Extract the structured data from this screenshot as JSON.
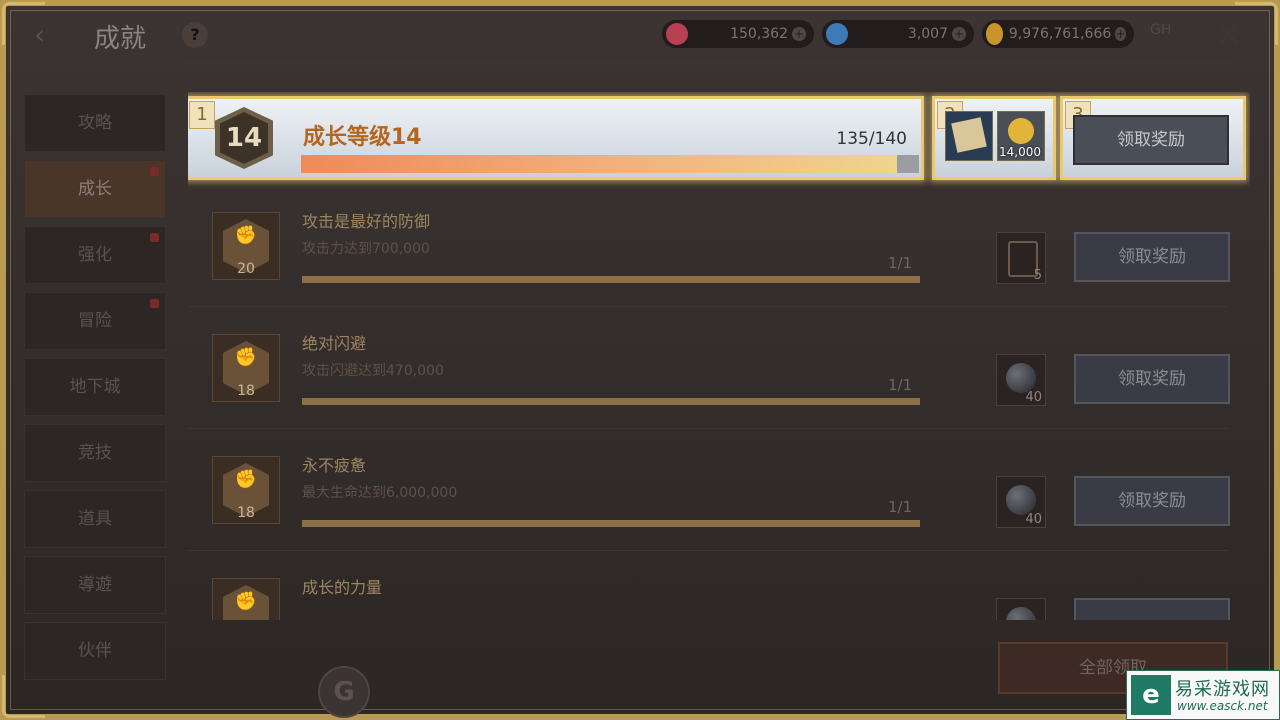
{
  "header": {
    "title": "成就",
    "help": "?",
    "currencies": [
      {
        "name": "red-gem",
        "value": "150,362",
        "color": "#b84050"
      },
      {
        "name": "blue-gem",
        "value": "3,007",
        "color": "#3e7ab8"
      },
      {
        "name": "gold",
        "value": "9,976,761,666",
        "color": "#c8952c"
      }
    ],
    "extra": "GH"
  },
  "sidebar": {
    "items": [
      {
        "label": "攻略",
        "dot": false,
        "active": false
      },
      {
        "label": "成长",
        "dot": true,
        "active": true
      },
      {
        "label": "强化",
        "dot": true,
        "active": false
      },
      {
        "label": "冒险",
        "dot": true,
        "active": false
      },
      {
        "label": "地下城",
        "dot": false,
        "active": false
      },
      {
        "label": "竞技",
        "dot": false,
        "active": false
      },
      {
        "label": "道具",
        "dot": false,
        "active": false
      },
      {
        "label": "導遊",
        "dot": false,
        "active": false
      },
      {
        "label": "伙伴",
        "dot": false,
        "active": false
      }
    ]
  },
  "highlight": {
    "markers": [
      "1",
      "2",
      "3"
    ],
    "level_badge": "14",
    "title": "成长等级14",
    "progress_text": "135/140",
    "progress": 0.964,
    "rewards": [
      {
        "icon": "scroll-icon",
        "count": ""
      },
      {
        "icon": "gold-coins-icon",
        "count": "14,000"
      }
    ],
    "button": "领取奖励"
  },
  "rows": [
    {
      "level": "20",
      "title": "攻击是最好的防御",
      "desc": "攻击力达到700,000",
      "progress_text": "1/1",
      "progress": 1,
      "reward_icon": "card-icon",
      "reward_count": "5",
      "button": "领取奖励"
    },
    {
      "level": "18",
      "title": "绝对闪避",
      "desc": "攻击闪避达到470,000",
      "progress_text": "1/1",
      "progress": 1,
      "reward_icon": "orb-icon",
      "reward_count": "40",
      "button": "领取奖励"
    },
    {
      "level": "18",
      "title": "永不疲惫",
      "desc": "最大生命达到6,000,000",
      "progress_text": "1/1",
      "progress": 1,
      "reward_icon": "orb-icon",
      "reward_count": "40",
      "button": "领取奖励"
    },
    {
      "level": "",
      "title": "成长的力量",
      "desc": "",
      "progress_text": "",
      "progress": 0,
      "reward_icon": "orb-icon",
      "reward_count": "",
      "button": ""
    }
  ],
  "footer": {
    "collect_all": "全部领取",
    "g_button": "G"
  },
  "watermark": {
    "name": "易采游戏网",
    "url": "www.easck.net",
    "logo": "e"
  }
}
